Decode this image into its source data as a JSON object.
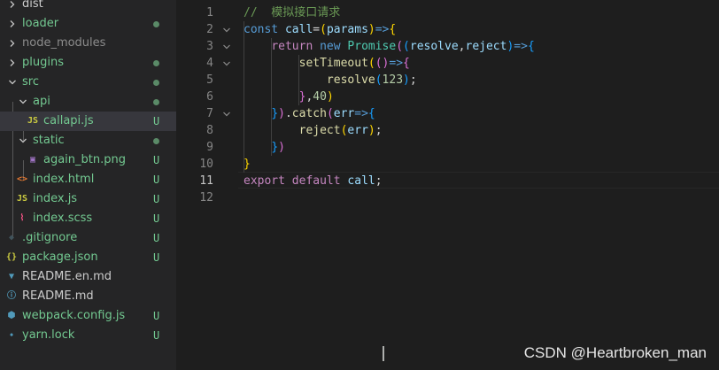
{
  "explorer": {
    "items": [
      {
        "name": "dist",
        "kind": "folder",
        "expanded": false,
        "depth": 0,
        "color": "#cccccc",
        "dot": false,
        "badge": ""
      },
      {
        "name": "loader",
        "kind": "folder",
        "expanded": false,
        "depth": 0,
        "color": "#73c991",
        "dot": true,
        "badge": ""
      },
      {
        "name": "node_modules",
        "kind": "folder",
        "expanded": false,
        "depth": 0,
        "color": "#8c8c8c",
        "dot": false,
        "badge": ""
      },
      {
        "name": "plugins",
        "kind": "folder",
        "expanded": false,
        "depth": 0,
        "color": "#73c991",
        "dot": true,
        "badge": ""
      },
      {
        "name": "src",
        "kind": "folder",
        "expanded": true,
        "depth": 0,
        "color": "#73c991",
        "dot": true,
        "badge": ""
      },
      {
        "name": "api",
        "kind": "folder",
        "expanded": true,
        "depth": 1,
        "color": "#73c991",
        "dot": true,
        "badge": ""
      },
      {
        "name": "callapi.js",
        "kind": "js",
        "expanded": false,
        "depth": 2,
        "color": "#73c991",
        "dot": false,
        "badge": "U",
        "selected": true
      },
      {
        "name": "static",
        "kind": "folder",
        "expanded": true,
        "depth": 1,
        "color": "#73c991",
        "dot": true,
        "badge": ""
      },
      {
        "name": "again_btn.png",
        "kind": "image",
        "expanded": false,
        "depth": 2,
        "color": "#73c991",
        "dot": false,
        "badge": "U"
      },
      {
        "name": "index.html",
        "kind": "html",
        "expanded": false,
        "depth": 1,
        "color": "#73c991",
        "dot": false,
        "badge": "U"
      },
      {
        "name": "index.js",
        "kind": "js",
        "expanded": false,
        "depth": 1,
        "color": "#73c991",
        "dot": false,
        "badge": "U"
      },
      {
        "name": "index.scss",
        "kind": "scss",
        "expanded": false,
        "depth": 1,
        "color": "#73c991",
        "dot": false,
        "badge": "U"
      },
      {
        "name": ".gitignore",
        "kind": "git",
        "expanded": false,
        "depth": 0,
        "color": "#73c991",
        "dot": false,
        "badge": "U"
      },
      {
        "name": "package.json",
        "kind": "json",
        "expanded": false,
        "depth": 0,
        "color": "#73c991",
        "dot": false,
        "badge": "U"
      },
      {
        "name": "README.en.md",
        "kind": "md",
        "expanded": false,
        "depth": 0,
        "color": "#cccccc",
        "dot": false,
        "badge": ""
      },
      {
        "name": "README.md",
        "kind": "info",
        "expanded": false,
        "depth": 0,
        "color": "#cccccc",
        "dot": false,
        "badge": ""
      },
      {
        "name": "webpack.config.js",
        "kind": "webpack",
        "expanded": false,
        "depth": 0,
        "color": "#73c991",
        "dot": false,
        "badge": "U"
      },
      {
        "name": "yarn.lock",
        "kind": "yarn",
        "expanded": false,
        "depth": 0,
        "color": "#73c991",
        "dot": false,
        "badge": "U"
      }
    ]
  },
  "editor": {
    "active_line": 11,
    "lines": [
      {
        "n": 1,
        "fold": false,
        "tokens": [
          {
            "t": "//  模拟接口请求",
            "c": "t-cmt"
          }
        ]
      },
      {
        "n": 2,
        "fold": true,
        "tokens": [
          {
            "t": "const ",
            "c": "t-kw"
          },
          {
            "t": "call",
            "c": "t-var"
          },
          {
            "t": "=",
            "c": "t-pun"
          },
          {
            "t": "(",
            "c": "t-brk1"
          },
          {
            "t": "params",
            "c": "t-var"
          },
          {
            "t": ")",
            "c": "t-brk1"
          },
          {
            "t": "=>",
            "c": "t-kw"
          },
          {
            "t": "{",
            "c": "t-brk1"
          }
        ]
      },
      {
        "n": 3,
        "fold": true,
        "tokens": [
          {
            "t": "    ",
            "c": "t-pun"
          },
          {
            "t": "return ",
            "c": "t-ctl"
          },
          {
            "t": "new ",
            "c": "t-kw"
          },
          {
            "t": "Promise",
            "c": "t-cls"
          },
          {
            "t": "(",
            "c": "t-brk2"
          },
          {
            "t": "(",
            "c": "t-brk3"
          },
          {
            "t": "resolve",
            "c": "t-var"
          },
          {
            "t": ",",
            "c": "t-pun"
          },
          {
            "t": "reject",
            "c": "t-var"
          },
          {
            "t": ")",
            "c": "t-brk3"
          },
          {
            "t": "=>",
            "c": "t-kw"
          },
          {
            "t": "{",
            "c": "t-brk3"
          }
        ]
      },
      {
        "n": 4,
        "fold": true,
        "tokens": [
          {
            "t": "        ",
            "c": "t-pun"
          },
          {
            "t": "setTimeout",
            "c": "t-fn"
          },
          {
            "t": "(",
            "c": "t-brk1"
          },
          {
            "t": "()",
            "c": "t-brk2"
          },
          {
            "t": "=>",
            "c": "t-kw"
          },
          {
            "t": "{",
            "c": "t-brk2"
          }
        ]
      },
      {
        "n": 5,
        "fold": false,
        "tokens": [
          {
            "t": "            ",
            "c": "t-pun"
          },
          {
            "t": "resolve",
            "c": "t-fn"
          },
          {
            "t": "(",
            "c": "t-brk3"
          },
          {
            "t": "123",
            "c": "t-num"
          },
          {
            "t": ")",
            "c": "t-brk3"
          },
          {
            "t": ";",
            "c": "t-pun"
          }
        ]
      },
      {
        "n": 6,
        "fold": false,
        "tokens": [
          {
            "t": "        ",
            "c": "t-pun"
          },
          {
            "t": "}",
            "c": "t-brk2"
          },
          {
            "t": ",",
            "c": "t-pun"
          },
          {
            "t": "40",
            "c": "t-num"
          },
          {
            "t": ")",
            "c": "t-brk1"
          }
        ]
      },
      {
        "n": 7,
        "fold": true,
        "tokens": [
          {
            "t": "    ",
            "c": "t-pun"
          },
          {
            "t": "}",
            "c": "t-brk3"
          },
          {
            "t": ")",
            "c": "t-brk2"
          },
          {
            "t": ".",
            "c": "t-pun"
          },
          {
            "t": "catch",
            "c": "t-fn"
          },
          {
            "t": "(",
            "c": "t-brk2"
          },
          {
            "t": "err",
            "c": "t-var"
          },
          {
            "t": "=>",
            "c": "t-kw"
          },
          {
            "t": "{",
            "c": "t-brk3"
          }
        ]
      },
      {
        "n": 8,
        "fold": false,
        "tokens": [
          {
            "t": "        ",
            "c": "t-pun"
          },
          {
            "t": "reject",
            "c": "t-fn"
          },
          {
            "t": "(",
            "c": "t-brk1"
          },
          {
            "t": "err",
            "c": "t-var"
          },
          {
            "t": ")",
            "c": "t-brk1"
          },
          {
            "t": ";",
            "c": "t-pun"
          }
        ]
      },
      {
        "n": 9,
        "fold": false,
        "tokens": [
          {
            "t": "    ",
            "c": "t-pun"
          },
          {
            "t": "}",
            "c": "t-brk3"
          },
          {
            "t": ")",
            "c": "t-brk2"
          }
        ]
      },
      {
        "n": 10,
        "fold": false,
        "tokens": [
          {
            "t": "}",
            "c": "t-brk1"
          }
        ]
      },
      {
        "n": 11,
        "fold": false,
        "tokens": [
          {
            "t": "export ",
            "c": "t-ctl"
          },
          {
            "t": "default ",
            "c": "t-ctl"
          },
          {
            "t": "call",
            "c": "t-var"
          },
          {
            "t": ";",
            "c": "t-pun"
          }
        ]
      },
      {
        "n": 12,
        "fold": false,
        "tokens": []
      }
    ]
  },
  "watermark": "CSDN @Heartbroken_man"
}
